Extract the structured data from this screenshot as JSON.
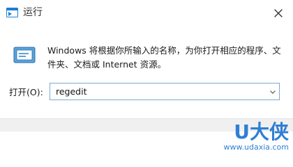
{
  "window": {
    "title": "运行",
    "close_icon": "close-icon"
  },
  "content": {
    "description": "Windows 将根据你所输入的名称，为你打开相应的程序、文件夹、文档或 Internet 资源。",
    "open_label": "打开(O):",
    "command_value": "regedit",
    "run_icon": "run-app-icon"
  },
  "colors": {
    "accent": "#1b7fd4",
    "input_border": "#7aa7d6",
    "footer_bg": "#f0f0f0",
    "watermark_blue": "#2f7fd3"
  },
  "watermark": {
    "brand": "U大侠",
    "url": "www.udaxia.com"
  }
}
